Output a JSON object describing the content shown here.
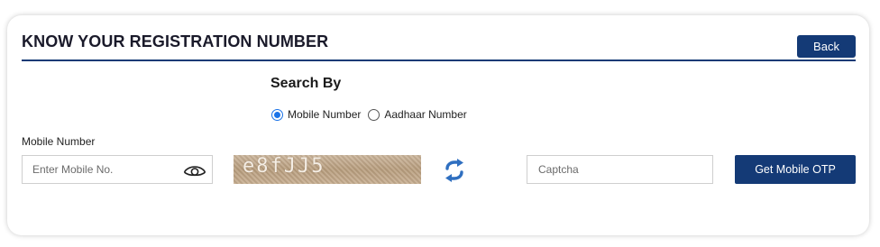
{
  "header": {
    "title": "KNOW YOUR REGISTRATION NUMBER",
    "back_label": "Back"
  },
  "search": {
    "heading": "Search By",
    "options": [
      {
        "label": "Mobile Number",
        "selected": true
      },
      {
        "label": "Aadhaar Number",
        "selected": false
      }
    ]
  },
  "form": {
    "mobile_label": "Mobile Number",
    "mobile_placeholder": "Enter Mobile No.",
    "captcha_text": "e8fJJ5",
    "captcha_placeholder": "Captcha",
    "submit_label": "Get Mobile OTP"
  },
  "icons": {
    "password_toggle": "eye-icon",
    "refresh": "refresh-icon"
  },
  "colors": {
    "primary": "#143a76",
    "radio_accent": "#1a73e8",
    "refresh_icon": "#2f6fc0"
  }
}
